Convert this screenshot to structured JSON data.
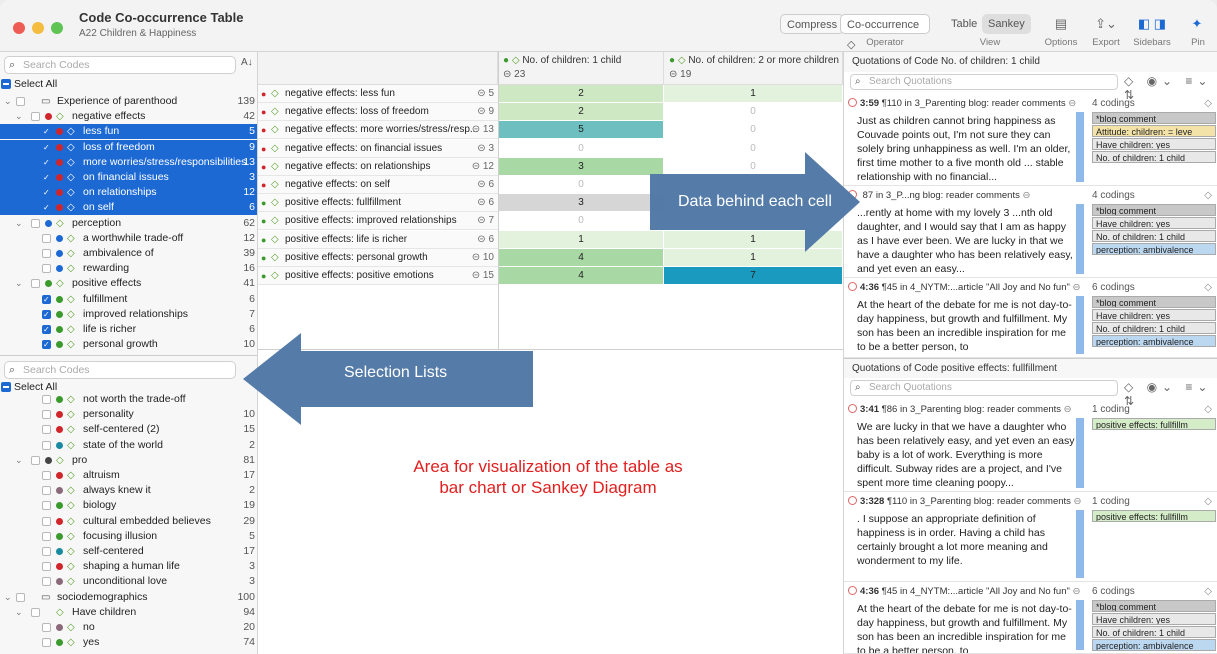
{
  "window": {
    "title": "Code Co-occurrence Table",
    "subtitle": "A22 Children & Happiness"
  },
  "toolbar": {
    "compress": "Compress",
    "operator_value": "Co-occurrence ◇",
    "operator_label": "Operator",
    "view_table": "Table",
    "view_sankey": "Sankey",
    "view_label": "View",
    "options_label": "Options",
    "export_label": "Export",
    "sidebars_label": "Sidebars",
    "pin_label": "Pin"
  },
  "left": {
    "search_placeholder": "Search Codes",
    "select_all": "Select All",
    "rows": [
      {
        "chev": "⌄",
        "label": "Experience of parenthood",
        "count": "139",
        "indent": 0,
        "icon": "folder",
        "dot": ""
      },
      {
        "chev": "⌄",
        "label": "negative effects",
        "count": "42",
        "indent": 1,
        "icon": "code",
        "dot": "#d0252a"
      },
      {
        "label": "less fun",
        "count": "5",
        "indent": 2,
        "icon": "code",
        "dot": "#d0252a",
        "sel": true,
        "check": true
      },
      {
        "label": "loss of freedom",
        "count": "9",
        "indent": 2,
        "icon": "code",
        "dot": "#d0252a",
        "sel": true,
        "check": true
      },
      {
        "label": "more worries/stress/responsibilities",
        "count": "13",
        "indent": 2,
        "icon": "code",
        "dot": "#d0252a",
        "sel": true,
        "check": true
      },
      {
        "label": "on financial issues",
        "count": "3",
        "indent": 2,
        "icon": "code",
        "dot": "#d0252a",
        "sel": true,
        "check": true
      },
      {
        "label": "on relationships",
        "count": "12",
        "indent": 2,
        "icon": "code",
        "dot": "#d0252a",
        "sel": true,
        "check": true
      },
      {
        "label": "on self",
        "count": "6",
        "indent": 2,
        "icon": "code",
        "dot": "#d0252a",
        "sel": true,
        "check": true
      },
      {
        "chev": "⌄",
        "label": "perception",
        "count": "62",
        "indent": 1,
        "icon": "code",
        "dot": "#1d69d4"
      },
      {
        "label": "a worthwhile trade-off",
        "count": "12",
        "indent": 2,
        "icon": "code",
        "dot": "#1d69d4"
      },
      {
        "label": "ambivalence of",
        "count": "39",
        "indent": 2,
        "icon": "code",
        "dot": "#1d69d4"
      },
      {
        "label": "rewarding",
        "count": "16",
        "indent": 2,
        "icon": "code",
        "dot": "#1d69d4"
      },
      {
        "chev": "⌄",
        "label": "positive effects",
        "count": "41",
        "indent": 1,
        "icon": "code",
        "dot": "#3a9a2c"
      },
      {
        "label": "fulfillment",
        "count": "6",
        "indent": 2,
        "icon": "code",
        "dot": "#3a9a2c",
        "check": true
      },
      {
        "label": "improved relationships",
        "count": "7",
        "indent": 2,
        "icon": "code",
        "dot": "#3a9a2c",
        "check": true
      },
      {
        "label": "life is richer",
        "count": "6",
        "indent": 2,
        "icon": "code",
        "dot": "#3a9a2c",
        "check": true
      },
      {
        "label": "personal growth",
        "count": "10",
        "indent": 2,
        "icon": "code",
        "dot": "#3a9a2c",
        "check": true
      }
    ],
    "search2_placeholder": "Search Codes",
    "select_all2": "Select All",
    "rows2": [
      {
        "label": "not worth the trade-off",
        "count": "",
        "indent": 2,
        "dot": "#3a9a2c"
      },
      {
        "label": "personality",
        "count": "10",
        "indent": 2,
        "dot": "#d0252a"
      },
      {
        "label": "self-centered (2)",
        "count": "15",
        "indent": 2,
        "dot": "#d0252a"
      },
      {
        "label": "state of the world",
        "count": "2",
        "indent": 2,
        "dot": "#1a8aa0"
      },
      {
        "chev": "⌄",
        "label": "pro",
        "count": "81",
        "indent": 1,
        "dot": "#444"
      },
      {
        "label": "altruism",
        "count": "17",
        "indent": 2,
        "dot": "#d0252a"
      },
      {
        "label": "always knew it",
        "count": "2",
        "indent": 2,
        "dot": "#8a6a7a"
      },
      {
        "label": "biology",
        "count": "19",
        "indent": 2,
        "dot": "#3a9a2c"
      },
      {
        "label": "cultural embedded believes",
        "count": "29",
        "indent": 2,
        "dot": "#d0252a"
      },
      {
        "label": "focusing illusion",
        "count": "5",
        "indent": 2,
        "dot": "#3a9a2c"
      },
      {
        "label": "self-centered",
        "count": "17",
        "indent": 2,
        "dot": "#1a8aa0"
      },
      {
        "label": "shaping a human life",
        "count": "3",
        "indent": 2,
        "dot": "#d0252a"
      },
      {
        "label": "unconditional love",
        "count": "3",
        "indent": 2,
        "dot": "#8a6a7a"
      },
      {
        "chev": "⌄",
        "label": "sociodemographics",
        "count": "100",
        "indent": 0,
        "dot": "",
        "folder": true
      },
      {
        "chev": "⌄",
        "label": "Have children",
        "count": "94",
        "indent": 1,
        "dot": ""
      },
      {
        "label": "no",
        "count": "20",
        "indent": 2,
        "dot": "#8a6a7a"
      },
      {
        "label": "yes",
        "count": "74",
        "indent": 2,
        "dot": "#3a9a2c"
      }
    ]
  },
  "table": {
    "col1": {
      "label": "No. of children: 1 child",
      "count": "23"
    },
    "col2": {
      "label": "No. of children: 2 or more  children",
      "count": "19"
    },
    "rows": [
      {
        "label": "negative effects: less fun",
        "count": "5",
        "dot": "#d0252a",
        "v1": "2",
        "v2": "1",
        "c1": "#cfe8c4",
        "c2": "#e3f2dc"
      },
      {
        "label": "negative effects: loss of freedom",
        "count": "9",
        "dot": "#d0252a",
        "v1": "2",
        "v2": "0",
        "c1": "#cfe8c4",
        "c2": "#ffffff"
      },
      {
        "label": "negative effects: more worries/stress/resp...",
        "count": "13",
        "dot": "#d0252a",
        "v1": "5",
        "v2": "0",
        "c1": "#6ec0c0",
        "c2": "#ffffff"
      },
      {
        "label": "negative effects: on financial issues",
        "count": "3",
        "dot": "#d0252a",
        "v1": "0",
        "v2": "0",
        "c1": "#ffffff",
        "c2": "#ffffff"
      },
      {
        "label": "negative effects: on relationships",
        "count": "12",
        "dot": "#d0252a",
        "v1": "3",
        "v2": "0",
        "c1": "#a8d8a4",
        "c2": "#ffffff"
      },
      {
        "label": "negative effects: on self",
        "count": "6",
        "dot": "#d0252a",
        "v1": "0",
        "v2": "0",
        "c1": "#ffffff",
        "c2": "#ffffff"
      },
      {
        "label": "positive effects: fullfillment",
        "count": "6",
        "dot": "#3a9a2c",
        "v1": "3",
        "v2": "0",
        "c1": "#d6d6d6",
        "c2": "#ffffff"
      },
      {
        "label": "positive effects: improved relationships",
        "count": "7",
        "dot": "#3a9a2c",
        "v1": "0",
        "v2": "0",
        "c1": "#ffffff",
        "c2": "#ffffff"
      },
      {
        "label": "positive effects: life is richer",
        "count": "6",
        "dot": "#3a9a2c",
        "v1": "1",
        "v2": "1",
        "c1": "#e3f2dc",
        "c2": "#e3f2dc"
      },
      {
        "label": "positive effects: personal growth",
        "count": "10",
        "dot": "#3a9a2c",
        "v1": "4",
        "v2": "1",
        "c1": "#a8d8a4",
        "c2": "#e3f2dc"
      },
      {
        "label": "positive effects: positive emotions",
        "count": "15",
        "dot": "#3a9a2c",
        "v1": "4",
        "v2": "7",
        "c1": "#a8d8a4",
        "c2": "#1a9abf"
      }
    ],
    "viz_label": "Area for visualization of the table as bar chart or Sankey Diagram"
  },
  "right": {
    "header1": "Quotations of Code No. of children: 1 child",
    "search1_placeholder": "Search Quotations",
    "quotes1": [
      {
        "num": "3:59",
        "meta": "¶110 in 3_Parenting blog: reader comments",
        "codings": "4 codings",
        "text": "Just as children cannot bring happiness as Couvade points out, I'm not sure they can solely bring unhappiness as well. I'm an older, first time mother to a five month old ... stable relationship with no financial...",
        "tags": [
          {
            "t": "*blog comment",
            "c": "#c8c8c8"
          },
          {
            "t": "Attitude: children: = leve",
            "c": "#f4e3a8"
          },
          {
            "t": "Have children: yes",
            "c": "#e8e8e8"
          },
          {
            "t": "No. of children: 1 child",
            "c": "#e8e8e8"
          }
        ]
      },
      {
        "num": "",
        "meta": "87 in 3_P...ng blog: reader comments",
        "codings": "4 codings",
        "text": "...rently at home with my lovely 3 ...nth old daughter, and I would say that I am as happy as I have ever been. We are lucky in that we have a daughter who has been relatively easy, and yet even an easy...",
        "tags": [
          {
            "t": "*blog comment",
            "c": "#c8c8c8"
          },
          {
            "t": "Have children: yes",
            "c": "#e8e8e8"
          },
          {
            "t": "No. of children: 1 child",
            "c": "#e8e8e8"
          },
          {
            "t": "perception: ambivalence",
            "c": "#bcd8f0"
          }
        ]
      },
      {
        "num": "4:36",
        "meta": "¶45 in 4_NYTM:...article \"All Joy and No fun\"",
        "codings": "6 codings",
        "text": "At the heart of the debate for me is not day-to-day happiness, but growth and fulfillment. My son has been an incredible inspiration for me to be a better person, to",
        "tags": [
          {
            "t": "*blog comment",
            "c": "#c8c8c8"
          },
          {
            "t": "Have children: yes",
            "c": "#e8e8e8"
          },
          {
            "t": "No. of children: 1 child",
            "c": "#e8e8e8"
          },
          {
            "t": "perception: ambivalence",
            "c": "#bcd8f0"
          }
        ]
      }
    ],
    "header2": "Quotations of Code positive effects: fullfillment",
    "search2_placeholder": "Search Quotations",
    "quotes2": [
      {
        "num": "3:41",
        "meta": "¶86 in 3_Parenting blog: reader comments",
        "codings": "1 coding",
        "text": "We are lucky in that we have a daughter who has been relatively easy, and yet even an easy baby is a lot of work. Everything is more difficult. Subway rides are a project, and I've spent more time cleaning poopy...",
        "tags": [
          {
            "t": "positive effects: fullfillm",
            "c": "#d4ecc8"
          }
        ]
      },
      {
        "num": "3:328",
        "meta": "¶110 in 3_Parenting blog: reader comments",
        "codings": "1 coding",
        "text": ". I suppose an appropriate definition of happiness is in order. Having a child has certainly brought a lot more meaning and wonderment to my life.",
        "tags": [
          {
            "t": "positive effects: fullfillm",
            "c": "#d4ecc8"
          }
        ]
      },
      {
        "num": "4:36",
        "meta": "¶45 in 4_NYTM:...article \"All Joy and No fun\"",
        "codings": "6 codings",
        "text": "At the heart of the debate for me is not day-to-day happiness, but growth and fulfillment. My son has been an incredible inspiration for me to be a better person, to",
        "tags": [
          {
            "t": "*blog comment",
            "c": "#c8c8c8"
          },
          {
            "t": "Have children: yes",
            "c": "#e8e8e8"
          },
          {
            "t": "No. of children: 1 child",
            "c": "#e8e8e8"
          },
          {
            "t": "perception: ambivalence",
            "c": "#bcd8f0"
          }
        ]
      }
    ]
  },
  "callouts": {
    "data_cell": "Data behind each cell",
    "selection": "Selection Lists"
  }
}
